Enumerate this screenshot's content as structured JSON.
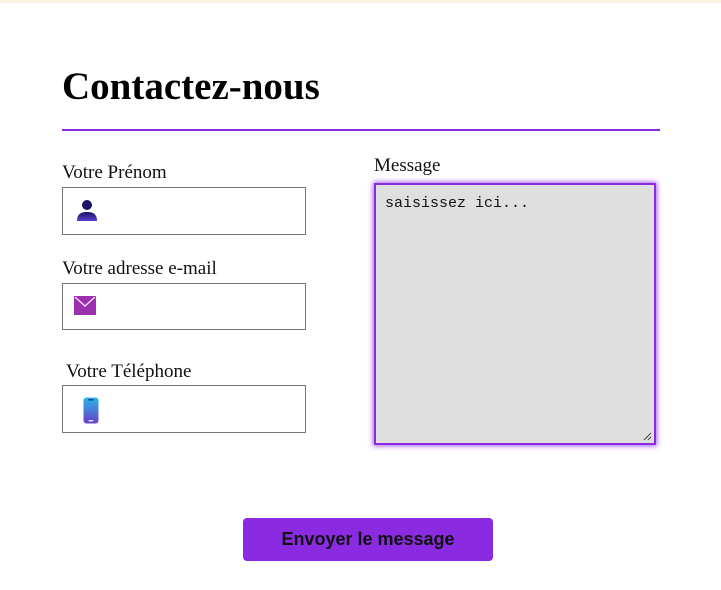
{
  "page": {
    "title": "Contactez-nous",
    "accent_color": "#8a2be2"
  },
  "form": {
    "first_name": {
      "label": "Votre Prénom",
      "value": "",
      "placeholder": "",
      "icon": "person-icon"
    },
    "email": {
      "label": "Votre adresse e-mail",
      "value": "",
      "placeholder": "",
      "icon": "envelope-icon"
    },
    "phone": {
      "label": "Votre Téléphone",
      "value": "",
      "placeholder": "",
      "icon": "mobile-phone-icon"
    },
    "message": {
      "label": "Message",
      "value": "",
      "placeholder": "saisissez ici..."
    },
    "submit_label": "Envoyer le message"
  }
}
